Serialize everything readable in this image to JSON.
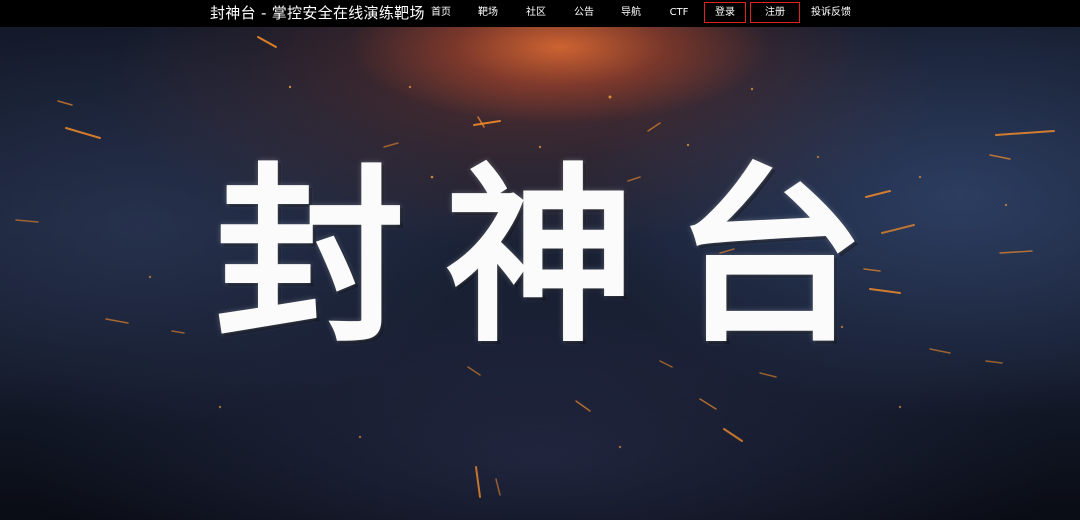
{
  "header": {
    "brand": "封神台 - 掌控安全在线演练靶场",
    "nav": [
      {
        "label": "首页"
      },
      {
        "label": "靶场"
      },
      {
        "label": "社区"
      },
      {
        "label": "公告"
      },
      {
        "label": "导航"
      },
      {
        "label": "CTF"
      },
      {
        "label": "登录"
      },
      {
        "label": "注册"
      },
      {
        "label": "投诉反馈"
      }
    ]
  },
  "hero": {
    "title": "封神台"
  },
  "colors": {
    "nav_bg": "#000000",
    "highlight_border": "#e0221c",
    "spark": "#f08a2a"
  }
}
